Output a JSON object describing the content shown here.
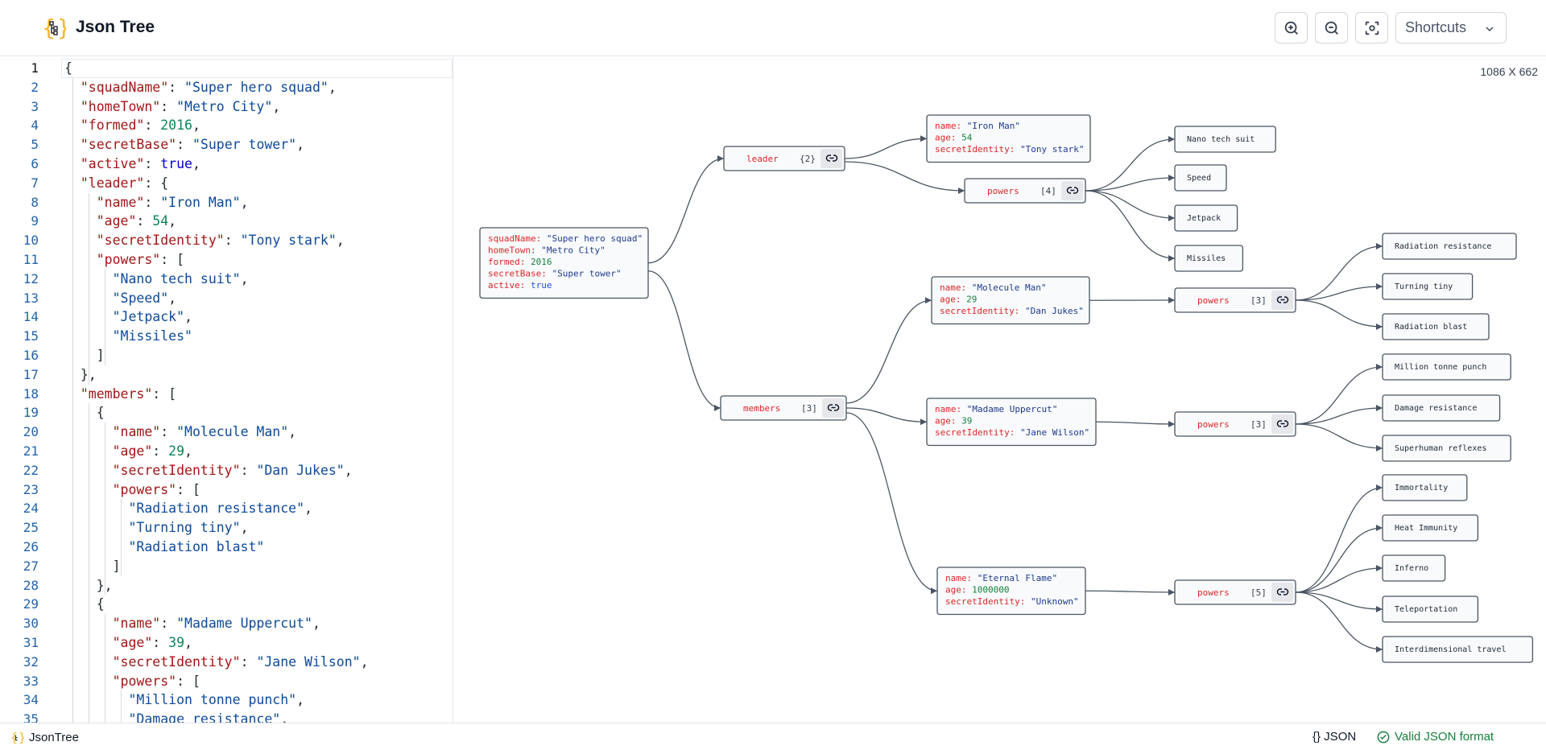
{
  "header": {
    "title": "Json Tree",
    "shortcuts_label": "Shortcuts"
  },
  "icons": {
    "logo": "json-tree-logo-icon",
    "zoom_in": "zoom-in-icon",
    "zoom_out": "zoom-out-icon",
    "fit": "focus-frame-icon",
    "link": "link-icon"
  },
  "editor": {
    "lines": [
      [
        [
          "p",
          "{"
        ]
      ],
      [
        [
          "p",
          "  "
        ],
        [
          "k",
          "\"squadName\""
        ],
        [
          "p",
          ": "
        ],
        [
          "s",
          "\"Super hero squad\""
        ],
        [
          "p",
          ","
        ]
      ],
      [
        [
          "p",
          "  "
        ],
        [
          "k",
          "\"homeTown\""
        ],
        [
          "p",
          ": "
        ],
        [
          "s",
          "\"Metro City\""
        ],
        [
          "p",
          ","
        ]
      ],
      [
        [
          "p",
          "  "
        ],
        [
          "k",
          "\"formed\""
        ],
        [
          "p",
          ": "
        ],
        [
          "n",
          "2016"
        ],
        [
          "p",
          ","
        ]
      ],
      [
        [
          "p",
          "  "
        ],
        [
          "k",
          "\"secretBase\""
        ],
        [
          "p",
          ": "
        ],
        [
          "s",
          "\"Super tower\""
        ],
        [
          "p",
          ","
        ]
      ],
      [
        [
          "p",
          "  "
        ],
        [
          "k",
          "\"active\""
        ],
        [
          "p",
          ": "
        ],
        [
          "b",
          "true"
        ],
        [
          "p",
          ","
        ]
      ],
      [
        [
          "p",
          "  "
        ],
        [
          "k",
          "\"leader\""
        ],
        [
          "p",
          ": {"
        ]
      ],
      [
        [
          "p",
          "    "
        ],
        [
          "k",
          "\"name\""
        ],
        [
          "p",
          ": "
        ],
        [
          "s",
          "\"Iron Man\""
        ],
        [
          "p",
          ","
        ]
      ],
      [
        [
          "p",
          "    "
        ],
        [
          "k",
          "\"age\""
        ],
        [
          "p",
          ": "
        ],
        [
          "n",
          "54"
        ],
        [
          "p",
          ","
        ]
      ],
      [
        [
          "p",
          "    "
        ],
        [
          "k",
          "\"secretIdentity\""
        ],
        [
          "p",
          ": "
        ],
        [
          "s",
          "\"Tony stark\""
        ],
        [
          "p",
          ","
        ]
      ],
      [
        [
          "p",
          "    "
        ],
        [
          "k",
          "\"powers\""
        ],
        [
          "p",
          ": ["
        ]
      ],
      [
        [
          "p",
          "      "
        ],
        [
          "s",
          "\"Nano tech suit\""
        ],
        [
          "p",
          ","
        ]
      ],
      [
        [
          "p",
          "      "
        ],
        [
          "s",
          "\"Speed\""
        ],
        [
          "p",
          ","
        ]
      ],
      [
        [
          "p",
          "      "
        ],
        [
          "s",
          "\"Jetpack\""
        ],
        [
          "p",
          ","
        ]
      ],
      [
        [
          "p",
          "      "
        ],
        [
          "s",
          "\"Missiles\""
        ]
      ],
      [
        [
          "p",
          "    ]"
        ]
      ],
      [
        [
          "p",
          "  },"
        ]
      ],
      [
        [
          "p",
          "  "
        ],
        [
          "k",
          "\"members\""
        ],
        [
          "p",
          ": ["
        ]
      ],
      [
        [
          "p",
          "    {"
        ]
      ],
      [
        [
          "p",
          "      "
        ],
        [
          "k",
          "\"name\""
        ],
        [
          "p",
          ": "
        ],
        [
          "s",
          "\"Molecule Man\""
        ],
        [
          "p",
          ","
        ]
      ],
      [
        [
          "p",
          "      "
        ],
        [
          "k",
          "\"age\""
        ],
        [
          "p",
          ": "
        ],
        [
          "n",
          "29"
        ],
        [
          "p",
          ","
        ]
      ],
      [
        [
          "p",
          "      "
        ],
        [
          "k",
          "\"secretIdentity\""
        ],
        [
          "p",
          ": "
        ],
        [
          "s",
          "\"Dan Jukes\""
        ],
        [
          "p",
          ","
        ]
      ],
      [
        [
          "p",
          "      "
        ],
        [
          "k",
          "\"powers\""
        ],
        [
          "p",
          ": ["
        ]
      ],
      [
        [
          "p",
          "        "
        ],
        [
          "s",
          "\"Radiation resistance\""
        ],
        [
          "p",
          ","
        ]
      ],
      [
        [
          "p",
          "        "
        ],
        [
          "s",
          "\"Turning tiny\""
        ],
        [
          "p",
          ","
        ]
      ],
      [
        [
          "p",
          "        "
        ],
        [
          "s",
          "\"Radiation blast\""
        ]
      ],
      [
        [
          "p",
          "      ]"
        ]
      ],
      [
        [
          "p",
          "    },"
        ]
      ],
      [
        [
          "p",
          "    {"
        ]
      ],
      [
        [
          "p",
          "      "
        ],
        [
          "k",
          "\"name\""
        ],
        [
          "p",
          ": "
        ],
        [
          "s",
          "\"Madame Uppercut\""
        ],
        [
          "p",
          ","
        ]
      ],
      [
        [
          "p",
          "      "
        ],
        [
          "k",
          "\"age\""
        ],
        [
          "p",
          ": "
        ],
        [
          "n",
          "39"
        ],
        [
          "p",
          ","
        ]
      ],
      [
        [
          "p",
          "      "
        ],
        [
          "k",
          "\"secretIdentity\""
        ],
        [
          "p",
          ": "
        ],
        [
          "s",
          "\"Jane Wilson\""
        ],
        [
          "p",
          ","
        ]
      ],
      [
        [
          "p",
          "      "
        ],
        [
          "k",
          "\"powers\""
        ],
        [
          "p",
          ": ["
        ]
      ],
      [
        [
          "p",
          "        "
        ],
        [
          "s",
          "\"Million tonne punch\""
        ],
        [
          "p",
          ","
        ]
      ],
      [
        [
          "p",
          "        "
        ],
        [
          "s",
          "\"Damage resistance\""
        ],
        [
          "p",
          ","
        ]
      ]
    ]
  },
  "canvas": {
    "dimensions_label": "1086 X 662",
    "root": [
      [
        [
          "k",
          "squadName: "
        ],
        [
          "v",
          "\"Super hero squad\""
        ]
      ],
      [
        [
          "k",
          "homeTown: "
        ],
        [
          "v",
          "\"Metro City\""
        ]
      ],
      [
        [
          "k",
          "formed: "
        ],
        [
          "n",
          "2016"
        ]
      ],
      [
        [
          "k",
          "secretBase: "
        ],
        [
          "v",
          "\"Super tower\""
        ]
      ],
      [
        [
          "k",
          "active: "
        ],
        [
          "b",
          "true"
        ]
      ]
    ],
    "leader": {
      "key": "leader",
      "count": "{2}"
    },
    "members": {
      "key": "members",
      "count": "[3]"
    },
    "leader_obj": [
      [
        [
          "k",
          "name: "
        ],
        [
          "v",
          "\"Iron Man\""
        ]
      ],
      [
        [
          "k",
          "age: "
        ],
        [
          "n",
          "54"
        ]
      ],
      [
        [
          "k",
          "secretIdentity: "
        ],
        [
          "v",
          "\"Tony stark\""
        ]
      ]
    ],
    "leader_powers": {
      "key": "powers",
      "count": "[4]",
      "items": [
        "Nano tech suit",
        "Speed",
        "Jetpack",
        "Missiles"
      ]
    },
    "member_objs": [
      [
        [
          [
            "k",
            "name: "
          ],
          [
            "v",
            "\"Molecule Man\""
          ]
        ],
        [
          [
            "k",
            "age: "
          ],
          [
            "n",
            "29"
          ]
        ],
        [
          [
            "k",
            "secretIdentity: "
          ],
          [
            "v",
            "\"Dan Jukes\""
          ]
        ]
      ],
      [
        [
          [
            "k",
            "name: "
          ],
          [
            "v",
            "\"Madame Uppercut\""
          ]
        ],
        [
          [
            "k",
            "age: "
          ],
          [
            "n",
            "39"
          ]
        ],
        [
          [
            "k",
            "secretIdentity: "
          ],
          [
            "v",
            "\"Jane Wilson\""
          ]
        ]
      ],
      [
        [
          [
            "k",
            "name: "
          ],
          [
            "v",
            "\"Eternal Flame\""
          ]
        ],
        [
          [
            "k",
            "age: "
          ],
          [
            "n",
            "1000000"
          ]
        ],
        [
          [
            "k",
            "secretIdentity: "
          ],
          [
            "v",
            "\"Unknown\""
          ]
        ]
      ]
    ],
    "member_powers": [
      {
        "key": "powers",
        "count": "[3]",
        "items": [
          "Radiation resistance",
          "Turning tiny",
          "Radiation blast"
        ]
      },
      {
        "key": "powers",
        "count": "[3]",
        "items": [
          "Million tonne punch",
          "Damage resistance",
          "Superhuman reflexes"
        ]
      },
      {
        "key": "powers",
        "count": "[5]",
        "items": [
          "Immortality",
          "Heat Immunity",
          "Inferno",
          "Teleportation",
          "Interdimensional travel"
        ]
      }
    ]
  },
  "footer": {
    "brand": "JsonTree",
    "format_label": "{} JSON",
    "valid_label": "Valid JSON format"
  },
  "colors": {
    "key": "#dc2626",
    "string": "#1e3a8a",
    "number": "#15803d",
    "boolean": "#1d4ed8",
    "valid": "#15803d"
  }
}
